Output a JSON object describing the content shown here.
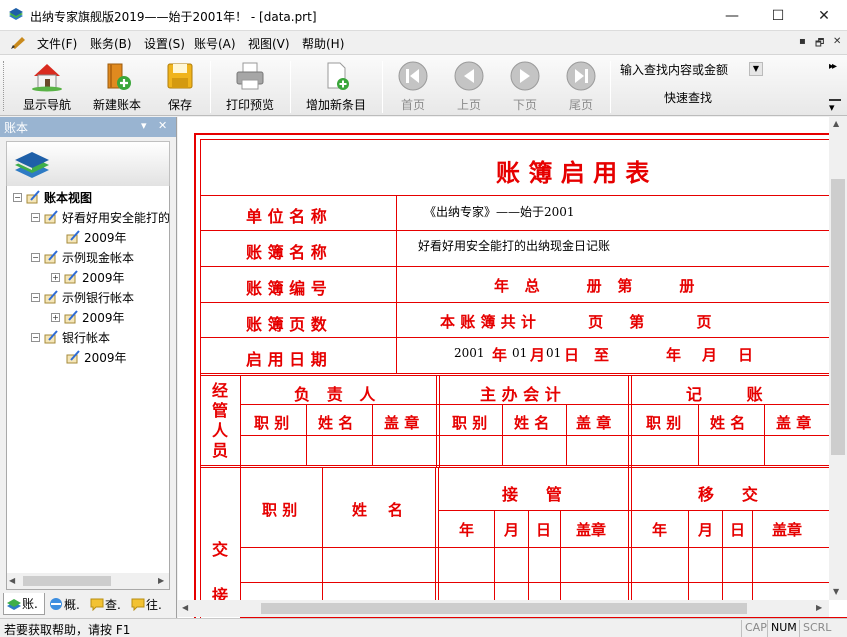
{
  "window": {
    "title": "出纳专家旗舰版2019——始于2001年！ - [data.prt]",
    "minimize_glyph": "—",
    "maximize_glyph": "☐",
    "close_glyph": "✕"
  },
  "menu": {
    "items": [
      "文件(F)",
      "账务(B)",
      "设置(S)",
      "账号(A)",
      "视图(V)",
      "帮助(H)"
    ],
    "mdi_controls": [
      "▪",
      "🗗",
      "✕"
    ]
  },
  "toolbar": {
    "buttons": [
      {
        "label": "显示导航",
        "icon": "home-icon",
        "enabled": true
      },
      {
        "label": "新建账本",
        "icon": "new-book-icon",
        "enabled": true
      },
      {
        "label": "保存",
        "icon": "save-icon",
        "enabled": true
      },
      {
        "label": "打印预览",
        "icon": "printer-icon",
        "enabled": true
      },
      {
        "label": "增加新条目",
        "icon": "add-entry-icon",
        "enabled": true
      },
      {
        "label": "首页",
        "icon": "first-page-icon",
        "enabled": false
      },
      {
        "label": "上页",
        "icon": "prev-page-icon",
        "enabled": false
      },
      {
        "label": "下页",
        "icon": "next-page-icon",
        "enabled": false
      },
      {
        "label": "尾页",
        "icon": "last-page-icon",
        "enabled": false
      }
    ],
    "search": {
      "placeholder": "输入查找内容或金额",
      "button_label": "快速查找"
    },
    "overflow_top": "▸▸",
    "overflow_bottom": "▾"
  },
  "sidebar": {
    "title": "账本",
    "controls": [
      "▾",
      "✕"
    ],
    "tree": [
      {
        "label": "账本视图",
        "level": 0,
        "expander": "−",
        "bold": true
      },
      {
        "label": "好看好用安全能打的",
        "level": 1,
        "expander": "−"
      },
      {
        "label": "2009年",
        "level": 2,
        "expander": ""
      },
      {
        "label": "示例现金帐本",
        "level": 1,
        "expander": "−"
      },
      {
        "label": "2009年",
        "level": 2,
        "expander": "+"
      },
      {
        "label": "示例银行帐本",
        "level": 1,
        "expander": "−"
      },
      {
        "label": "2009年",
        "level": 2,
        "expander": "+"
      },
      {
        "label": "银行帐本",
        "level": 1,
        "expander": "−"
      },
      {
        "label": "2009年",
        "level": 2,
        "expander": ""
      }
    ],
    "tabs": [
      "账.",
      "概.",
      "查.",
      "往."
    ]
  },
  "ledger": {
    "title": "账 簿 启 用 表",
    "rows": [
      {
        "label": "单 位 名 称",
        "value": "《出纳专家》——始于2001"
      },
      {
        "label": "账 簿 名 称",
        "value": "好看好用安全能打的出纳现金日记账"
      },
      {
        "label": "账 簿 编 号",
        "value": "年   总         册   第         册"
      },
      {
        "label": "账 簿 页 数",
        "value": "本 账 簿 共 计          页     第          页"
      },
      {
        "label": "启 用 日 期",
        "value_year": "2001",
        "value_y_label": "年",
        "value_month": "01",
        "value_m_label": "月",
        "value_day": "01",
        "value_d_label": "日",
        "value_to": "至",
        "value_y2": "年",
        "value_m2": "月",
        "value_d2": "日"
      }
    ],
    "personnel": {
      "side_label": [
        "经",
        "管",
        "人",
        "员"
      ],
      "groups": [
        "负   责   人",
        "主 办 会 计",
        "记        账"
      ],
      "sub_headers": [
        "职 别",
        "姓 名",
        "盖 章"
      ]
    },
    "handover": {
      "side_label": [
        "交",
        "接"
      ],
      "col_job": "职 别",
      "col_name": "姓    名",
      "group_receive": "接     管",
      "group_transfer": "移     交",
      "sub_headers": [
        "年",
        "月",
        "日",
        "盖章"
      ]
    }
  },
  "status": {
    "message": "若要获取帮助，请按 F1",
    "indicators": [
      "CAP",
      "NUM",
      "SCRL"
    ]
  }
}
